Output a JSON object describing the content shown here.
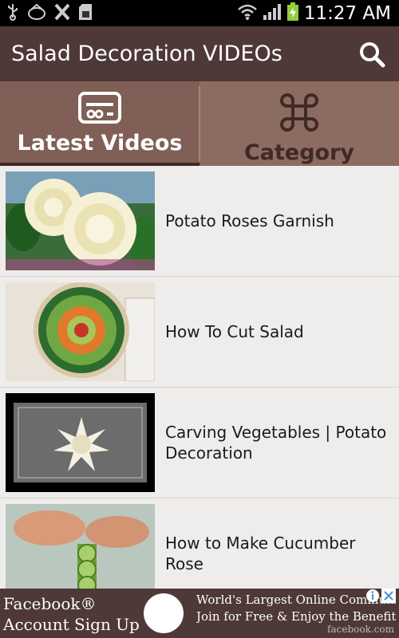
{
  "status_bar": {
    "time": "11:27 AM",
    "left_icons": [
      "usb-icon",
      "notification-icon",
      "x-icon",
      "sd-card-icon"
    ],
    "right_icons": [
      "wifi-icon",
      "signal-icon",
      "battery-charging-icon"
    ]
  },
  "app_bar": {
    "title": "Salad Decoration VIDEOs",
    "search_icon": "search-icon"
  },
  "tabs": [
    {
      "label": "Latest Videos",
      "icon": "video-card-icon",
      "active": true
    },
    {
      "label": "Category",
      "icon": "command-icon",
      "active": false
    }
  ],
  "videos": [
    {
      "title": "Potato Roses Garnish",
      "thumb": "potato-roses-thumbnail"
    },
    {
      "title": "How To Cut Salad",
      "thumb": "cut-salad-thumbnail"
    },
    {
      "title": "Carving Vegetables | Potato Decoration",
      "thumb": "carving-vegetables-thumbnail"
    },
    {
      "title": "How to Make Cucumber Rose",
      "thumb": "cucumber-rose-thumbnail"
    }
  ],
  "ad": {
    "left_line1": "Facebook®",
    "left_line2": "Account Sign Up",
    "right_line1": "World's Largest Online Community",
    "right_line2": "Join for Free & Enjoy the Benefits!",
    "source": "facebook.com"
  },
  "colors": {
    "app_bar": "#4e3838",
    "tab_bar": "#8c6b61",
    "tab_active_text": "#ffffff",
    "tab_inactive_text": "#3e2a26",
    "list_bg": "#efedeb"
  }
}
